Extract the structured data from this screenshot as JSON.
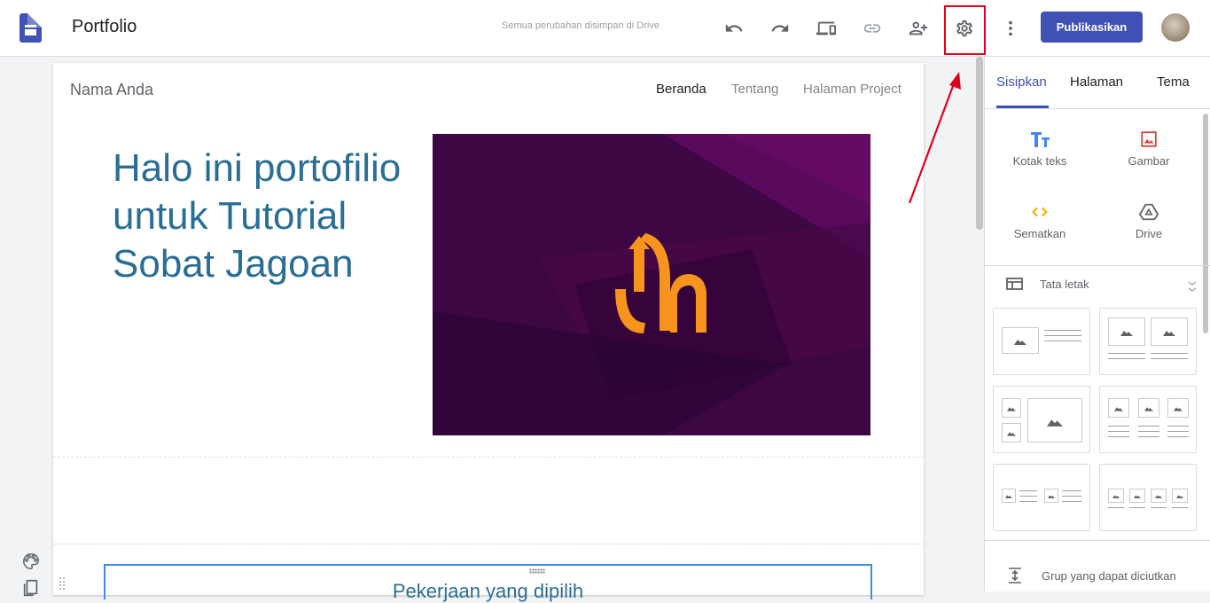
{
  "app": {
    "title": "Portfolio",
    "save_status": "Semua perubahan disimpan di Drive",
    "publish_label": "Publikasikan"
  },
  "toolbar": {
    "icons": [
      "undo-icon",
      "redo-icon",
      "preview-icon",
      "link-icon",
      "add-person-icon",
      "gear-icon",
      "more-vert-icon"
    ]
  },
  "site": {
    "name": "Nama Anda",
    "nav": [
      "Beranda",
      "Tentang",
      "Halaman Project"
    ],
    "active_nav": "Beranda",
    "hero_text": "Halo ini portofilio untuk Tutorial Sobat Jagoan",
    "section_title": "Pekerjaan yang dipilih"
  },
  "panel": {
    "tabs": [
      "Sisipkan",
      "Halaman",
      "Tema"
    ],
    "active_tab": "Sisipkan",
    "insert": {
      "text_box": "Kotak teks",
      "image": "Gambar",
      "embed": "Sematkan",
      "drive": "Drive"
    },
    "layout_title": "Tata letak",
    "collapsible_group": "Grup yang dapat diciutkan"
  },
  "colors": {
    "accent": "#3f51b5",
    "hero_text": "#2a6e95",
    "highlight": "#e3001b",
    "logo_orange": "#f7941d"
  }
}
